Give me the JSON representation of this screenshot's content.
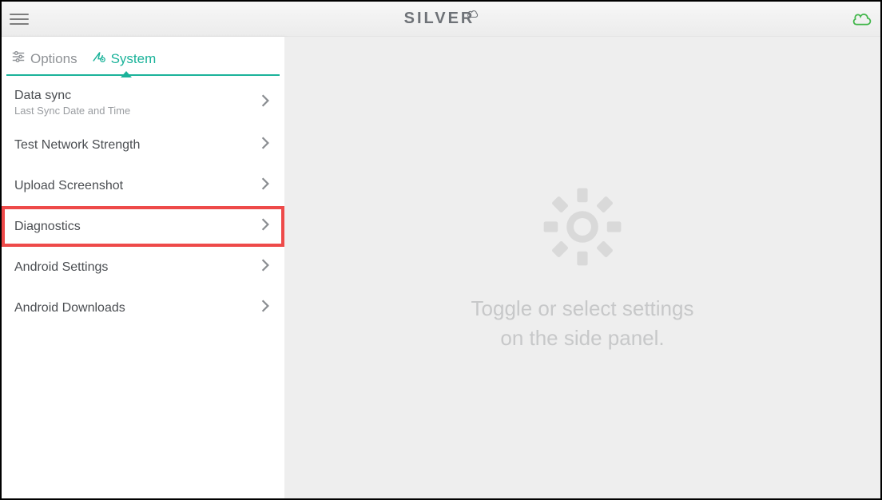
{
  "header": {
    "brand": "SILVER"
  },
  "tabs": {
    "options": "Options",
    "system": "System"
  },
  "menu": {
    "data_sync": {
      "title": "Data sync",
      "subtitle": "Last Sync Date and Time"
    },
    "test_network": {
      "title": "Test Network Strength"
    },
    "upload_screenshot": {
      "title": "Upload Screenshot"
    },
    "diagnostics": {
      "title": "Diagnostics"
    },
    "android_settings": {
      "title": "Android Settings"
    },
    "android_downloads": {
      "title": "Android Downloads"
    }
  },
  "content": {
    "placeholder_line1": "Toggle or select settings",
    "placeholder_line2": "on the side panel."
  },
  "colors": {
    "accent": "#1bb39a",
    "highlight": "#ee4a49",
    "cloud": "#41b64a"
  }
}
